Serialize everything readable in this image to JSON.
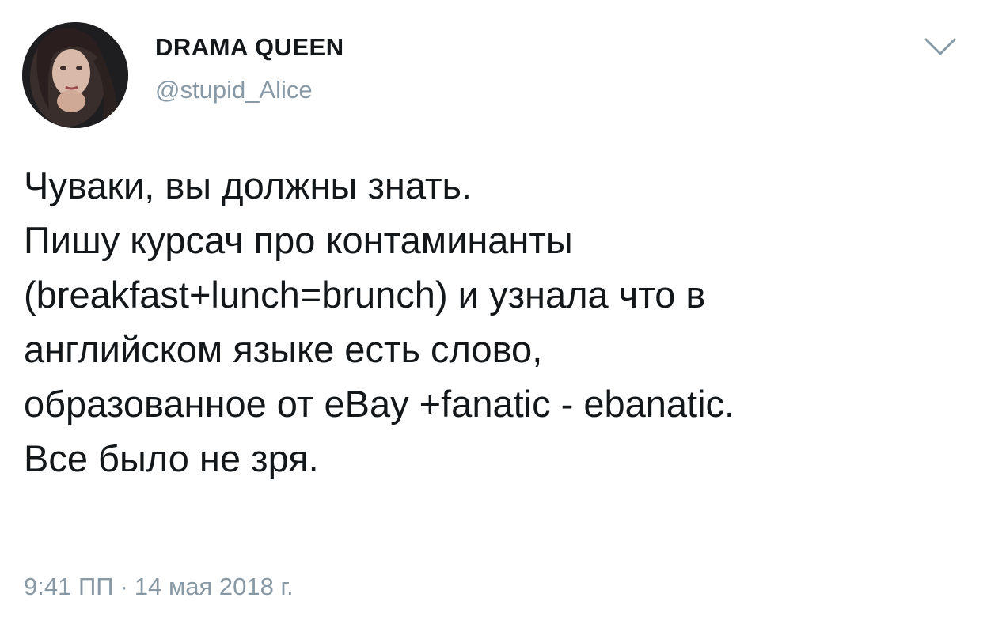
{
  "author": {
    "display_name": "DRAMA QUEEN",
    "handle": "@stupid_Alice"
  },
  "tweet": {
    "lines": [
      "Чуваки, вы должны знать.",
      "Пишу курсач про контаминанты",
      "(breakfast+lunch=brunch) и узнала что в",
      "английском языке есть слово,",
      "образованное от eBay +fanatic - ebanatic.",
      "Все было не зря."
    ]
  },
  "meta": {
    "time": "9:41 ПП",
    "separator": "·",
    "date": "14 мая 2018 г."
  },
  "icons": {
    "menu": "chevron-down-icon",
    "avatar": "avatar-photo"
  },
  "colors": {
    "text": "#14171a",
    "secondary": "#8899a6",
    "background": "#ffffff"
  }
}
